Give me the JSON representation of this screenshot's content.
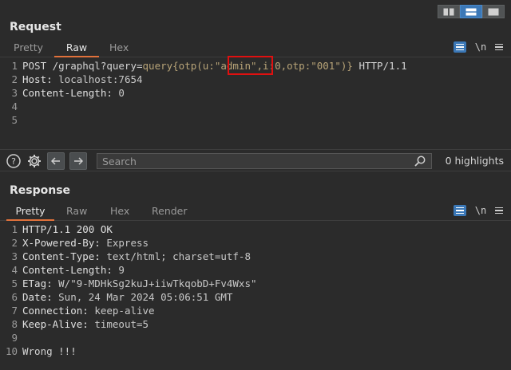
{
  "layout_buttons": [
    "split-horizontal",
    "split-vertical",
    "single-pane"
  ],
  "request": {
    "title": "Request",
    "tabs": [
      "Pretty",
      "Raw",
      "Hex"
    ],
    "active_tab": "Raw",
    "tools": {
      "newline_label": "\\n"
    },
    "lines": [
      {
        "num": "1",
        "parts": [
          [
            "k",
            "POST /graphql?query="
          ],
          [
            "hv",
            "query{otp(u:\"admin\",i:0,otp:\"001\")}"
          ],
          [
            "k",
            " HTTP/1.1"
          ]
        ]
      },
      {
        "num": "2",
        "parts": [
          [
            "hn",
            "Host: "
          ],
          [
            "hvv",
            "localhost:7654"
          ]
        ]
      },
      {
        "num": "3",
        "parts": [
          [
            "hn",
            "Content-Length: "
          ],
          [
            "hvv",
            "0"
          ]
        ]
      },
      {
        "num": "4",
        "parts": []
      },
      {
        "num": "5",
        "parts": []
      }
    ]
  },
  "search": {
    "placeholder": "Search",
    "highlights_label": "0 highlights"
  },
  "response": {
    "title": "Response",
    "tabs": [
      "Pretty",
      "Raw",
      "Hex",
      "Render"
    ],
    "active_tab": "Pretty",
    "tools": {
      "newline_label": "\\n"
    },
    "lines": [
      {
        "num": "1",
        "parts": [
          [
            "hn",
            "HTTP/1.1 200 OK"
          ]
        ]
      },
      {
        "num": "2",
        "parts": [
          [
            "hn",
            "X-Powered-By: "
          ],
          [
            "hvv",
            "Express"
          ]
        ]
      },
      {
        "num": "3",
        "parts": [
          [
            "hn",
            "Content-Type: "
          ],
          [
            "hvv",
            "text/html; charset=utf-8"
          ]
        ]
      },
      {
        "num": "4",
        "parts": [
          [
            "hn",
            "Content-Length: "
          ],
          [
            "hvv",
            "9"
          ]
        ]
      },
      {
        "num": "5",
        "parts": [
          [
            "hn",
            "ETag: "
          ],
          [
            "hvv",
            "W/\"9-MDHkSg2kuJ+iiwTkqobD+Fv4Wxs\""
          ]
        ]
      },
      {
        "num": "6",
        "parts": [
          [
            "hn",
            "Date: "
          ],
          [
            "hvv",
            "Sun, 24 Mar 2024 05:06:51 GMT"
          ]
        ]
      },
      {
        "num": "7",
        "parts": [
          [
            "hn",
            "Connection: "
          ],
          [
            "hvv",
            "keep-alive"
          ]
        ]
      },
      {
        "num": "8",
        "parts": [
          [
            "hn",
            "Keep-Alive: "
          ],
          [
            "hvv",
            "timeout=5"
          ]
        ]
      },
      {
        "num": "9",
        "parts": []
      },
      {
        "num": "10",
        "parts": [
          [
            "k",
            "Wrong !!!"
          ]
        ]
      }
    ]
  },
  "colors": {
    "accent_tab": "#e0713b",
    "accent_button": "#3b78b7",
    "highlight_box": "#e01010"
  }
}
